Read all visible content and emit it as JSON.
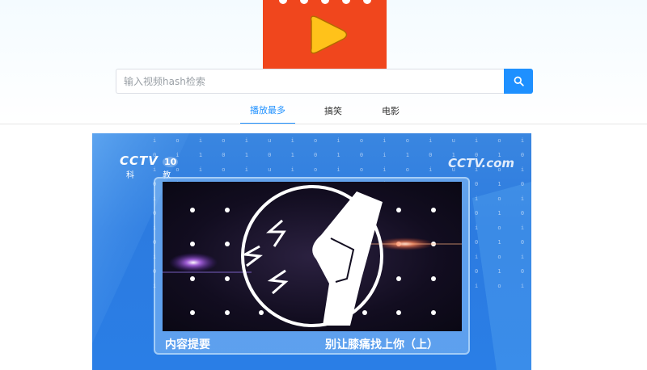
{
  "search": {
    "placeholder": "输入视频hash检索",
    "button_icon": "search-icon"
  },
  "tabs": [
    {
      "label": "播放最多",
      "active": true
    },
    {
      "label": "搞笑",
      "active": false
    },
    {
      "label": "电影",
      "active": false
    }
  ],
  "video": {
    "channel_logo": "CCTV",
    "channel_number": "10",
    "channel_name": "科 教",
    "watermark": "CCTV.com",
    "caption_left": "内容提要",
    "caption_right": "别让膝痛找上你（上）"
  },
  "colors": {
    "logo_bg": "#f0461d",
    "logo_play": "#ffc21a",
    "accent": "#1e90ff"
  }
}
